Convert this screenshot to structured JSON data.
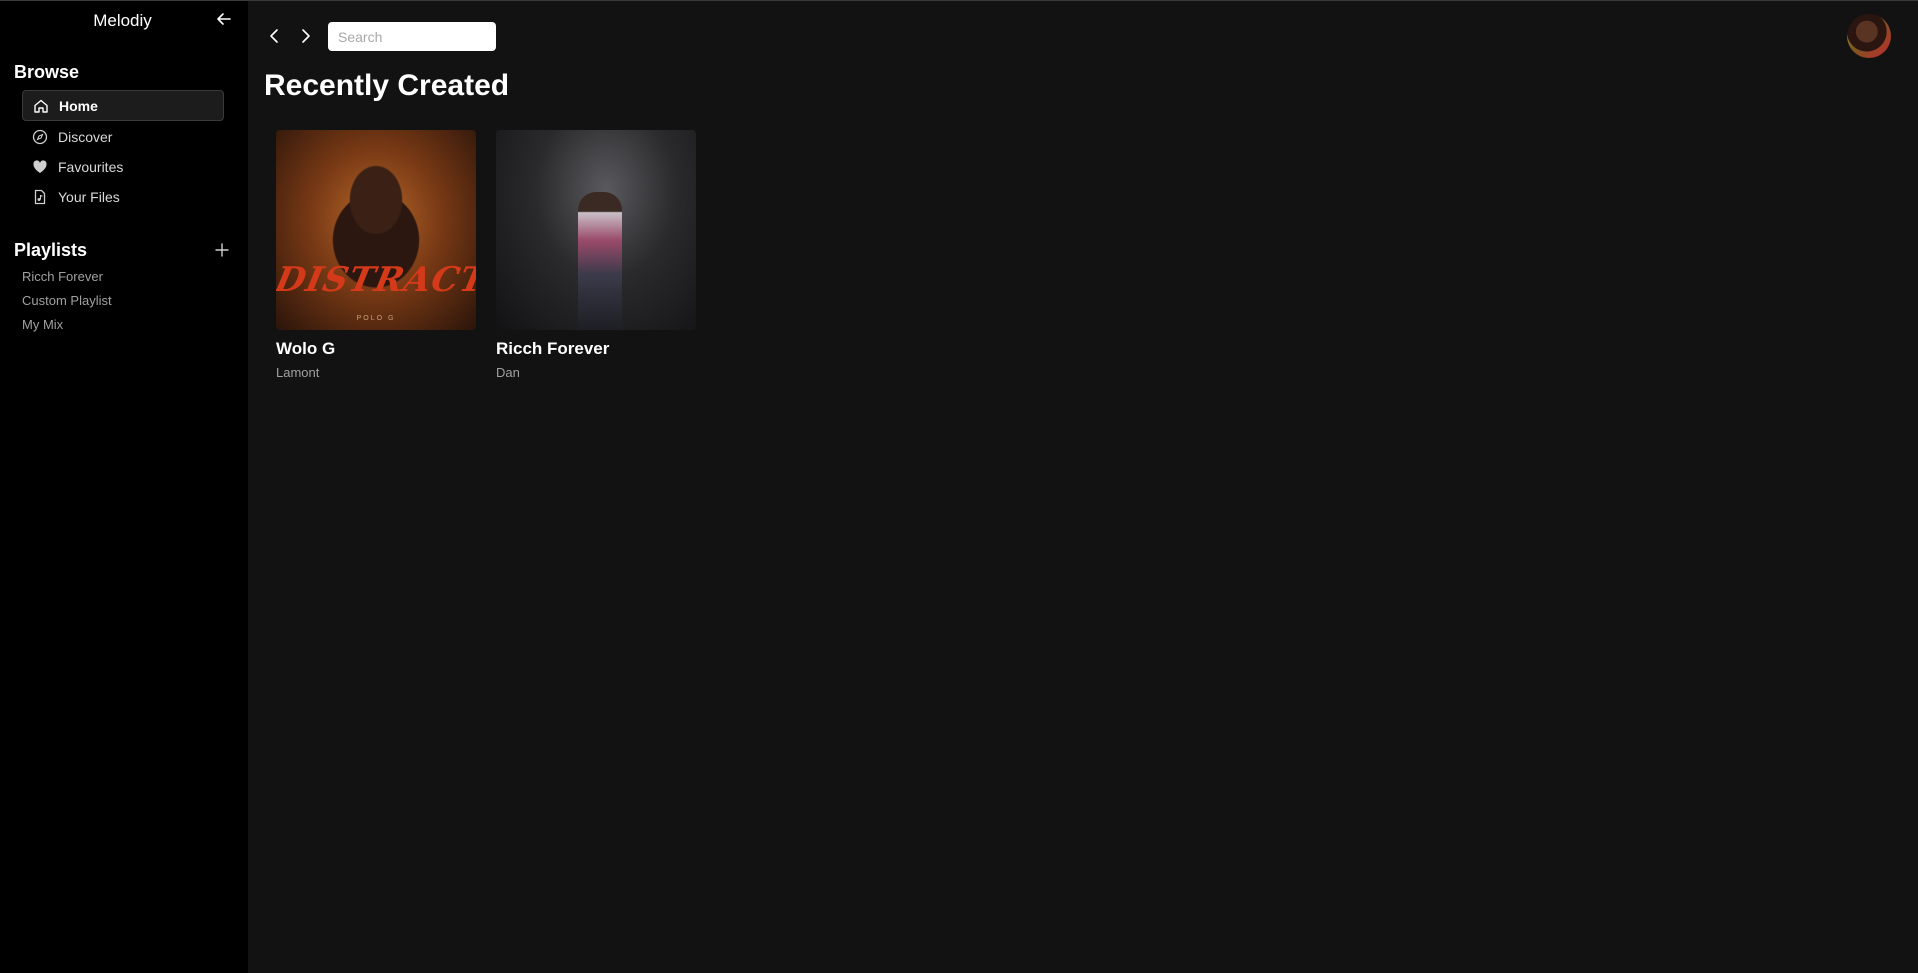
{
  "app": {
    "title": "Melodiy"
  },
  "sidebar": {
    "browse_title": "Browse",
    "items": [
      {
        "label": "Home",
        "icon": "home-icon",
        "active": true
      },
      {
        "label": "Discover",
        "icon": "compass-icon",
        "active": false
      },
      {
        "label": "Favourites",
        "icon": "heart-icon",
        "active": false
      },
      {
        "label": "Your Files",
        "icon": "file-icon",
        "active": false
      }
    ],
    "playlists_title": "Playlists",
    "playlists": [
      "Ricch Forever",
      "Custom Playlist",
      "My Mix"
    ]
  },
  "header": {
    "search_placeholder": "Search"
  },
  "main": {
    "title": "Recently Created",
    "cards": [
      {
        "name": "Wolo G",
        "artist": "Lamont",
        "cover_text": "DISTRACTION",
        "cover_sub": "POLO G"
      },
      {
        "name": "Ricch Forever",
        "artist": "Dan"
      }
    ]
  },
  "colors": {
    "sidebar_bg": "#000000",
    "main_bg": "#131213",
    "accent_text": "#ffffff",
    "muted_text": "#a0a0a0"
  }
}
